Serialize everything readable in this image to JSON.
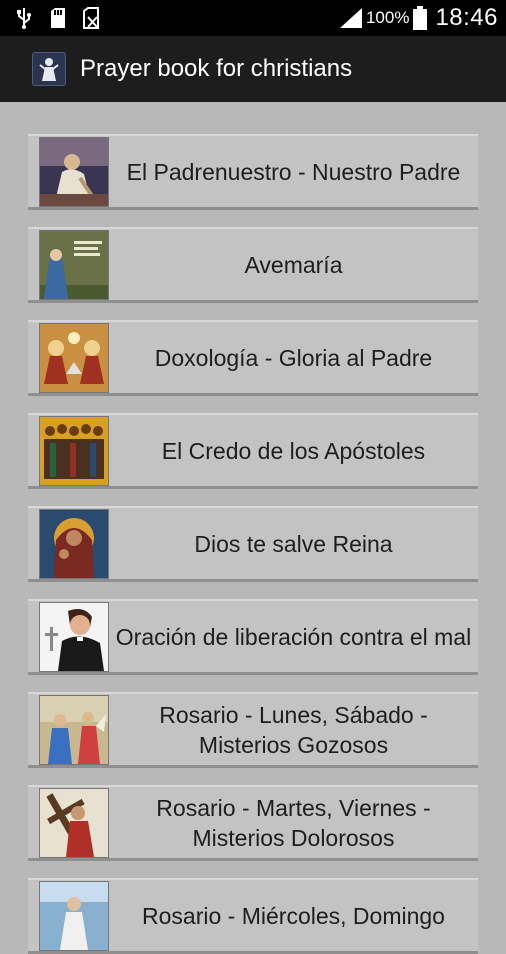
{
  "status_bar": {
    "battery_percent": "100%",
    "time": "18:46",
    "icons": [
      "usb-icon",
      "sd-card-icon",
      "sim-disabled-icon",
      "signal-icon",
      "battery-icon"
    ]
  },
  "action_bar": {
    "app_icon": "app-logo-icon",
    "title": "Prayer book for christians"
  },
  "prayers": [
    {
      "label": "El Padrenuestro - Nuestro Padre",
      "thumb": "jesus-praying-image"
    },
    {
      "label": "Avemaría",
      "thumb": "virgin-mary-image"
    },
    {
      "label": "Doxología - Gloria al Padre",
      "thumb": "holy-trinity-image"
    },
    {
      "label": "El Credo de los Apóstoles",
      "thumb": "apostles-icon-image"
    },
    {
      "label": "Dios te salve Reina",
      "thumb": "madonna-icon-image"
    },
    {
      "label": "Oración de liberación contra el mal",
      "thumb": "priest-cross-image"
    },
    {
      "label": "Rosario - Lunes, Sábado - Misterios Gozosos",
      "thumb": "annunciation-image"
    },
    {
      "label": "Rosario - Martes, Viernes - Misterios Dolorosos",
      "thumb": "jesus-carrying-cross-image"
    },
    {
      "label": "Rosario - Miércoles, Domingo",
      "thumb": "glorious-mysteries-image"
    }
  ]
}
